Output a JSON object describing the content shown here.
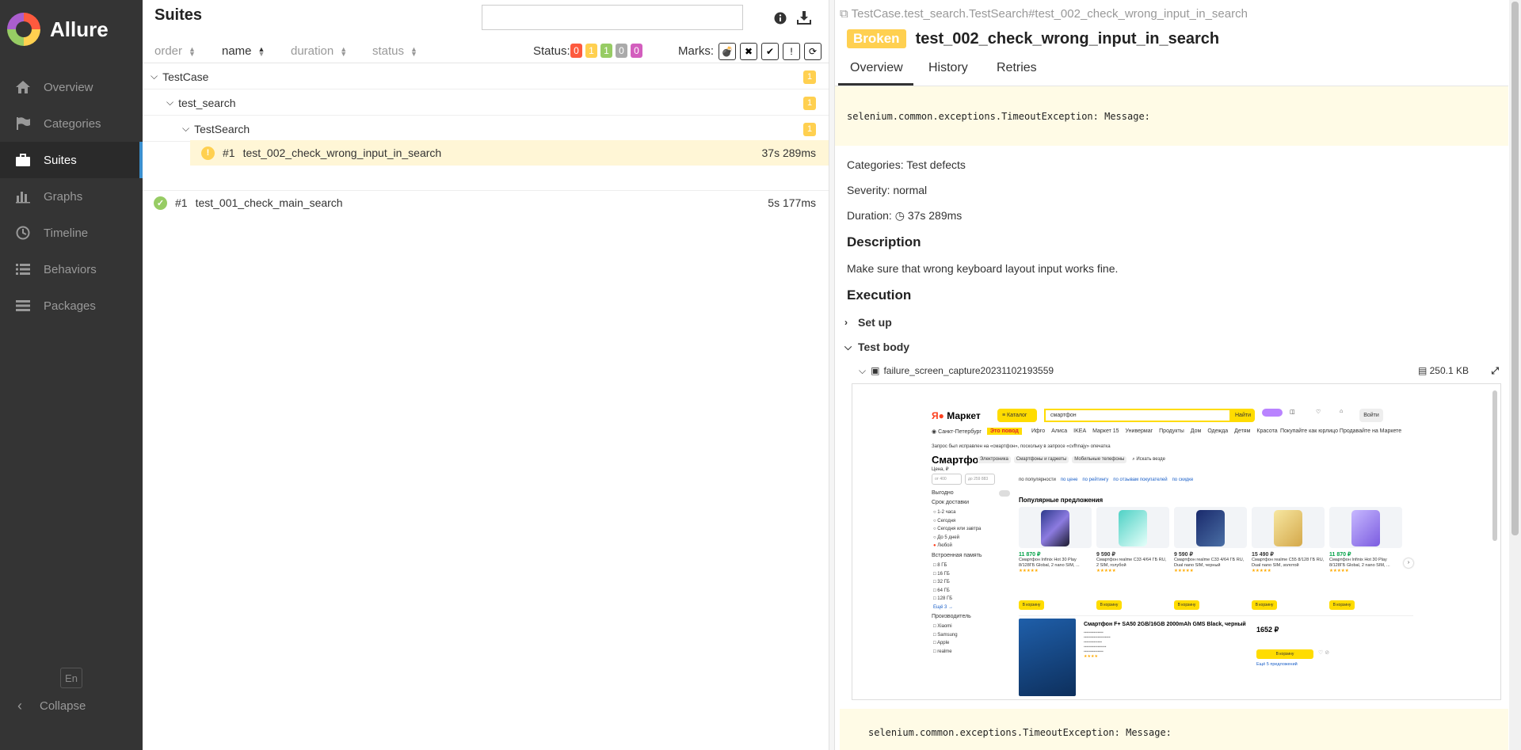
{
  "app": {
    "name": "Allure"
  },
  "sidebar": {
    "items": [
      {
        "label": "Overview",
        "icon": "home-icon"
      },
      {
        "label": "Categories",
        "icon": "flag-icon"
      },
      {
        "label": "Suites",
        "icon": "briefcase-icon",
        "active": true
      },
      {
        "label": "Graphs",
        "icon": "bar-chart-icon"
      },
      {
        "label": "Timeline",
        "icon": "clock-icon"
      },
      {
        "label": "Behaviors",
        "icon": "list-icon"
      },
      {
        "label": "Packages",
        "icon": "list-icon"
      }
    ],
    "lang": "En",
    "collapse": "Collapse"
  },
  "suites": {
    "title": "Suites",
    "search_placeholder": "",
    "sort": {
      "order": "order",
      "name": "name",
      "duration": "duration",
      "status": "status"
    },
    "status_label": "Status:",
    "status_counts": [
      {
        "value": "0",
        "color": "#fd5a3e"
      },
      {
        "value": "1",
        "color": "#ffd050"
      },
      {
        "value": "1",
        "color": "#97cc64"
      },
      {
        "value": "0",
        "color": "#aaaaaa"
      },
      {
        "value": "0",
        "color": "#d35ebe"
      }
    ],
    "marks_label": "Marks:",
    "tree": {
      "root": {
        "name": "TestCase",
        "count": "1"
      },
      "child": {
        "name": "test_search",
        "count": "1"
      },
      "grandchild": {
        "name": "TestSearch",
        "count": "1"
      },
      "broken_test": {
        "index": "#1",
        "name": "test_002_check_wrong_input_in_search",
        "duration": "37s 289ms"
      },
      "passed_test": {
        "index": "#1",
        "name": "test_001_check_main_search",
        "duration": "5s 177ms"
      }
    }
  },
  "detail": {
    "breadcrumb": "TestCase.test_search.TestSearch#test_002_check_wrong_input_in_search",
    "status": "Broken",
    "title": "test_002_check_wrong_input_in_search",
    "tabs": [
      "Overview",
      "History",
      "Retries"
    ],
    "message": "selenium.common.exceptions.TimeoutException: Message:",
    "categories": "Categories: Test defects",
    "severity": "Severity: normal",
    "duration_label": "Duration:",
    "duration": "37s 289ms",
    "description_heading": "Description",
    "description": "Make sure that wrong keyboard layout input works fine.",
    "execution_heading": "Execution",
    "setup": "Set up",
    "test_body": "Test body",
    "attachment": {
      "name": "failure_screen_capture20231102193559",
      "size": "250.1 KB"
    },
    "message2": "selenium.common.exceptions.TimeoutException: Message:"
  },
  "screenshot": {
    "logo": "Маркет",
    "catalog": "Каталог",
    "search_value": "смартфон",
    "search_button": "Найти",
    "login": "Войти",
    "city": "Санкт-Петербург",
    "promo": "Это повод",
    "nav_links": [
      "Ифго",
      "Алиса",
      "IKEA",
      "Маркет 15",
      "Универмаг",
      "Продукты",
      "Дом",
      "Одежда",
      "Детям",
      "Красота"
    ],
    "right_links": "Покупайте как юрлицо   Продавайте на Маркете",
    "query_note": "Запрос был исправлен на «смартфон», поскольку в запросе «cvfhnajy» опечатка",
    "heading": "Смартфон",
    "chips": [
      "Электроника",
      "Смартфоны и гаджеты",
      "Мобильные телефоны"
    ],
    "search_in": "Искать везде",
    "sort_links": [
      "по популярности",
      "по цене",
      "по рейтингу",
      "по отзывам покупателей",
      "по скидке"
    ],
    "price_label": "Цена, ₽",
    "price_from": "от 400",
    "price_to": "до 259 883",
    "profitable": "Выгодно",
    "delivery_label": "Срок доставки",
    "delivery": [
      "1-2 часа",
      "Сегодня",
      "Сегодня или завтра",
      "До 5 дней",
      "Любой"
    ],
    "memory_label": "Встроенная память",
    "memory": [
      "8 ГБ",
      "16 ГБ",
      "32 ГБ",
      "64 ГБ",
      "128 ГБ"
    ],
    "more": "Ещё 3 →",
    "maker_label": "Производитель",
    "makers": [
      "Xiaomi",
      "Samsung",
      "Apple",
      "realme"
    ],
    "popular": "Популярные предложения",
    "cards": [
      {
        "price": "11 870 ₽",
        "name": "Смартфон Infinix Hot 30 Play 8/128ГБ Global, 2 nano SIM, ..."
      },
      {
        "price": "9 590 ₽",
        "name": "Смартфон realme C33 4/64 ГБ RU, 2 SIM, голубой"
      },
      {
        "price": "9 590 ₽",
        "name": "Смартфон realme C33 4/64 ГБ RU, Dual nano SIM, черный"
      },
      {
        "price": "15 490 ₽",
        "name": "Смартфон realme C55 8/128 ГБ RU, Dual nano SIM, золотой"
      },
      {
        "price": "11 870 ₽",
        "name": "Смартфон Infinix Hot 30 Play 8/128ГБ Global, 2 nano SIM, ..."
      }
    ],
    "to_cart": "В корзину",
    "listing_title": "Смартфон F+ SA50 2GB/16GB 2000mAh GMS Black, черный",
    "listing_price": "1652 ₽",
    "listing_more": "Ещё 5 предложений"
  }
}
